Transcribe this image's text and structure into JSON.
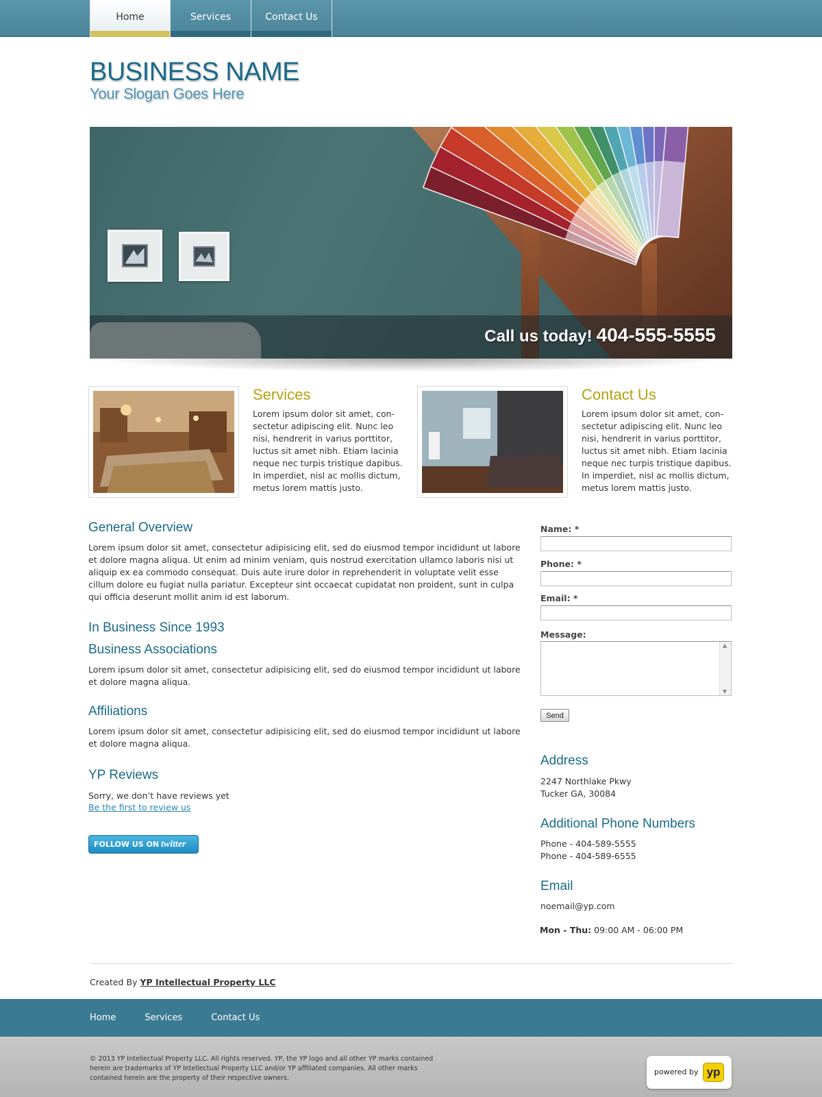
{
  "nav": {
    "items": [
      {
        "label": "Home",
        "active": true
      },
      {
        "label": "Services",
        "active": false
      },
      {
        "label": "Contact Us",
        "active": false
      }
    ]
  },
  "brand": {
    "name": "BUSINESS NAME",
    "slogan": "Your Slogan Goes Here"
  },
  "hero": {
    "call_text": "Call us today!",
    "phone": "404-555-5555"
  },
  "features": [
    {
      "title": "Services",
      "text": "Lorem ipsum dolor sit amet, con-sectetur adipiscing elit. Nunc leo nisi, hendrerit in varius porttitor, luctus sit amet nibh. Etiam lacinia neque nec turpis tristique dapibus. In imperdiet, nisl ac mollis dictum, metus lorem mattis justo."
    },
    {
      "title": "Contact Us",
      "text": "Lorem ipsum dolor sit amet, con-sectetur adipiscing elit. Nunc leo nisi, hendrerit in varius porttitor, luctus sit amet nibh. Etiam lacinia neque nec turpis tristique dapibus. In imperdiet, nisl ac mollis dictum, metus lorem mattis justo."
    }
  ],
  "main": {
    "overview_title": "General Overview",
    "overview_text": "Lorem ipsum dolor sit amet, consectetur adipisicing elit, sed do eiusmod tempor incididunt ut labore et dolore magna aliqua. Ut enim ad minim veniam, quis nostrud exercitation ullamco laboris nisi ut aliquip ex ea commodo consequat. Duis aute irure dolor in reprehenderit in voluptate velit esse cillum dolore eu fugiat nulla pariatur. Excepteur sint occaecat cupidatat non proident, sunt in culpa qui officia deserunt mollit anim id est laborum.",
    "since_title": "In Business Since 1993",
    "associations_title": "Business Associations",
    "associations_text": "Lorem ipsum dolor sit amet, consectetur adipisicing elit, sed do eiusmod tempor incididunt ut labore et dolore magna aliqua.",
    "affiliations_title": "Affiliations",
    "affiliations_text": "Lorem ipsum dolor sit amet, consectetur adipisicing elit, sed do eiusmod tempor incididunt ut labore et dolore magna aliqua.",
    "reviews_title": "YP Reviews",
    "reviews_text": "Sorry, we don’t have reviews yet",
    "reviews_link": "Be the first to review us",
    "twitter_prefix": "FOLLOW US ON",
    "twitter_brand": "twitter"
  },
  "form": {
    "name_label": "Name: *",
    "name_value": "",
    "phone_label": "Phone: *",
    "phone_value": "",
    "email_label": "Email: *",
    "email_value": "",
    "message_label": "Message:",
    "message_value": "",
    "send_label": "Send"
  },
  "info": {
    "address_title": "Address",
    "address_line1": "2247 Northlake Pkwy",
    "address_line2": "Tucker GA, 30084",
    "phones_title": "Additional Phone Numbers",
    "phone1": "Phone - 404-589-5555",
    "phone2": "Phone - 404-589-6555",
    "email_title": "Email",
    "email": "noemail@yp.com",
    "hours_days": "Mon - Thu:",
    "hours_time": "09:00 AM - 06:00 PM"
  },
  "footer": {
    "created_prefix": "Created By",
    "created_link": "YP Intellectual Property LLC",
    "links": [
      "Home",
      "Services",
      "Contact Us"
    ],
    "legal": "© 2013  YP Intellectual Property LLC. All rights reserved. YP, the YP logo and all other YP marks contained herein are trademarks of YP Intellectual Property LLC and/or YP affiliated companies. All other marks contained herein are the property of their respective owners.",
    "powered_by": "powered by",
    "yp_logo": "yp"
  },
  "colors": {
    "nav_bg": "#5b95aa",
    "heading_blue": "#1a6a8a",
    "feature_gold": "#b8a00f",
    "footer_nav": "#3b7a92",
    "legal_band": "#bdbdbd",
    "yp_yellow": "#f5cf00"
  },
  "icons": {
    "scroll_up": "scroll-up-arrow-icon",
    "scroll_down": "scroll-down-arrow-icon"
  }
}
